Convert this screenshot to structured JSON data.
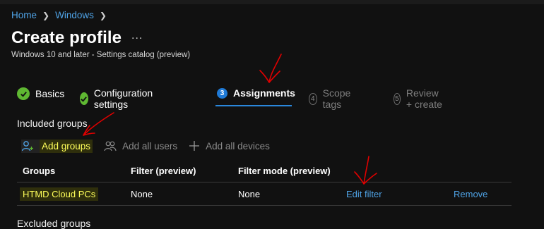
{
  "breadcrumb": {
    "items": [
      "Home",
      "Windows"
    ]
  },
  "page": {
    "title": "Create profile",
    "more_label": "...",
    "subtitle": "Windows 10 and later - Settings catalog (preview)"
  },
  "steps": [
    {
      "label": "Basics",
      "state": "done"
    },
    {
      "label": "Configuration settings",
      "state": "done"
    },
    {
      "number": "3",
      "label": "Assignments",
      "state": "current"
    },
    {
      "number": "4",
      "label": "Scope tags",
      "state": "todo"
    },
    {
      "number": "5",
      "label": "Review + create",
      "state": "todo"
    }
  ],
  "included": {
    "heading": "Included groups",
    "actions": {
      "add_groups": "Add groups",
      "add_all_users": "Add all users",
      "add_all_devices": "Add all devices"
    },
    "table": {
      "headers": [
        "Groups",
        "Filter (preview)",
        "Filter mode (preview)"
      ],
      "rows": [
        {
          "group": "HTMD Cloud PCs",
          "filter": "None",
          "filter_mode": "None",
          "edit": "Edit filter",
          "remove": "Remove"
        }
      ]
    }
  },
  "excluded": {
    "heading": "Excluded groups"
  },
  "colors": {
    "background": "#111111",
    "accent": "#2a87dc",
    "link": "#4fa3e6",
    "success": "#5fb832",
    "highlight_text": "#ffff5a",
    "annotation": "#e00000"
  },
  "icons": [
    "chevron-right-icon",
    "more-icon",
    "checkmark-icon",
    "add-person-icon",
    "users-icon",
    "plus-icon"
  ]
}
